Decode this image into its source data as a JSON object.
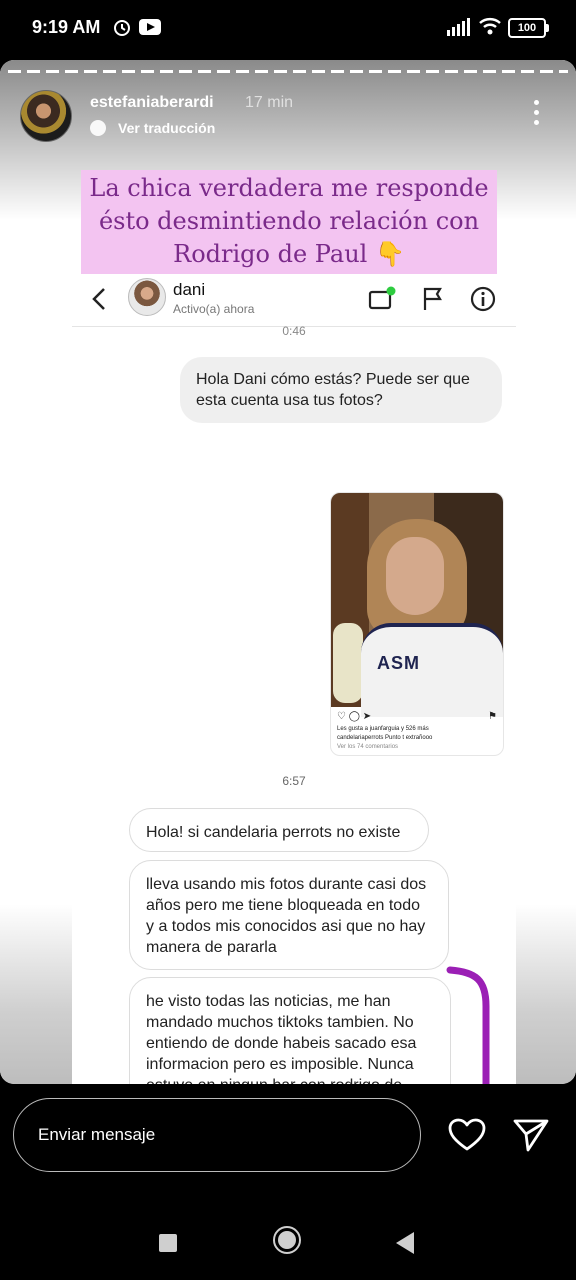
{
  "status_bar": {
    "time": "9:19 AM",
    "battery": "100"
  },
  "story": {
    "username": "estefaniaberardi",
    "time_ago": "17 min",
    "translate": "Ver traducción",
    "caption": "La chica verdadera me responde ésto desmintiendo relación con Rodrigo de Paul 👇"
  },
  "dm": {
    "contact_name": "dani",
    "contact_status": "Activo(a) ahora",
    "timestamp_top": "0:46",
    "outgoing_message": "Hola Dani cómo estás? Puede ser que esta cuenta usa tus fotos?",
    "shared_post": {
      "photo_logo": "ASM",
      "likes": "Les gusta a juanfarguia y 526 más",
      "caption": "candelariaperrots Punto t extrañooo",
      "comments": "Ver los 74 comentarios"
    },
    "timestamp_mid": "6:57",
    "incoming_messages": [
      "Hola! si candelaria perrots no existe",
      "lleva usando mis fotos durante casi dos años pero me tiene bloqueada en todo y a todos mis conocidos asi que no hay manera de pararla",
      "he visto todas las noticias, me han mandado muchos tiktoks tambien. No entiendo de donde habeis sacado esa informacion pero es imposible. Nunca estuve en ningun bar con rodrigo de paul."
    ]
  },
  "reply": {
    "placeholder": "Enviar mensaje"
  },
  "colors": {
    "caption_bg": "#f3c4f1",
    "caption_text": "#7a2a8a",
    "bracket": "#9b1fb5",
    "online_dot": "#2ecc40"
  }
}
